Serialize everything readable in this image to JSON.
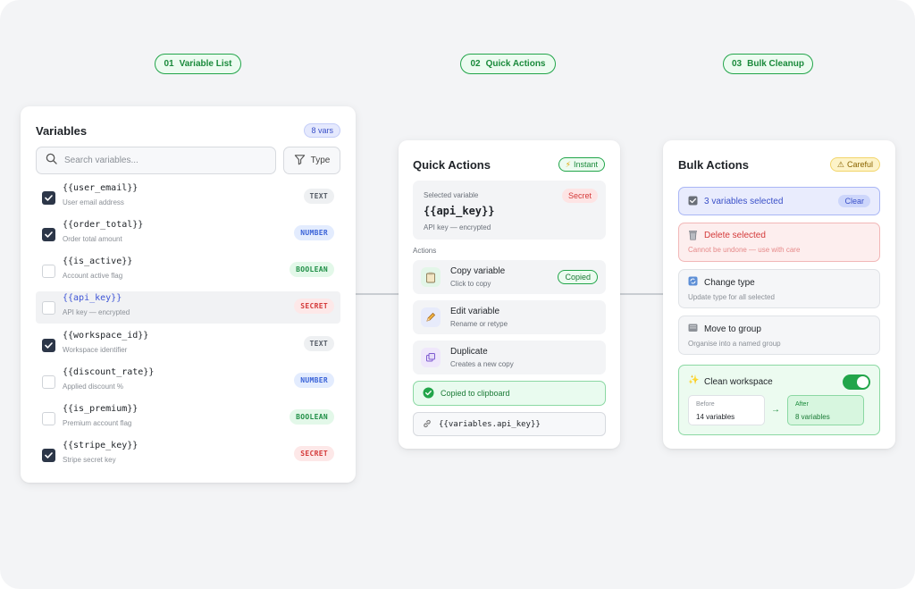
{
  "steps": [
    {
      "num": "01",
      "label": "Variable List"
    },
    {
      "num": "02",
      "label": "Quick Actions"
    },
    {
      "num": "03",
      "label": "Bulk Cleanup"
    }
  ],
  "variables_card": {
    "title": "Variables",
    "count_badge": "8 vars",
    "search_placeholder": "Search variables...",
    "type_filter_label": "Type",
    "rows": [
      {
        "name": "{{user_email}}",
        "desc": "User email address",
        "type": "TEXT",
        "checked": true
      },
      {
        "name": "{{order_total}}",
        "desc": "Order total amount",
        "type": "NUMBER",
        "checked": true
      },
      {
        "name": "{{is_active}}",
        "desc": "Account active flag",
        "type": "BOOLEAN",
        "checked": false
      },
      {
        "name": "{{api_key}}",
        "desc": "API key — encrypted",
        "type": "SECRET",
        "checked": false,
        "highlighted": true
      },
      {
        "name": "{{workspace_id}}",
        "desc": "Workspace identifier",
        "type": "TEXT",
        "checked": true
      },
      {
        "name": "{{discount_rate}}",
        "desc": "Applied discount %",
        "type": "NUMBER",
        "checked": false
      },
      {
        "name": "{{is_premium}}",
        "desc": "Premium account flag",
        "type": "BOOLEAN",
        "checked": false
      },
      {
        "name": "{{stripe_key}}",
        "desc": "Stripe secret key",
        "type": "SECRET",
        "checked": true
      }
    ]
  },
  "quick_actions_card": {
    "title": "Quick Actions",
    "badge": "Instant",
    "selected_label": "Selected variable",
    "selected_tag": "Secret",
    "selected_value": "{{api_key}}",
    "selected_desc": "API key — encrypted",
    "actions_label": "Actions",
    "actions": [
      {
        "label": "Copy variable",
        "desc": "Click to copy",
        "icon": "clipboard-icon",
        "status": "Copied"
      },
      {
        "label": "Edit variable",
        "desc": "Rename or retype",
        "icon": "pencil-icon"
      },
      {
        "label": "Duplicate",
        "desc": "Creates a new copy",
        "icon": "duplicate-icon"
      }
    ],
    "toast": "Copied to clipboard",
    "reference": "{{variables.api_key}}"
  },
  "bulk_card": {
    "title": "Bulk Actions",
    "badge": "Careful",
    "selection_label": "3 variables selected",
    "clear_label": "Clear",
    "delete_label": "Delete selected",
    "delete_desc": "Cannot be undone — use with care",
    "change_type_label": "Change type",
    "change_type_desc": "Update type for all selected",
    "move_label": "Move to group",
    "move_desc": "Organise into a named group",
    "clean_label": "Clean workspace",
    "clean_enabled": true,
    "before_label": "Before",
    "before_value": "14 variables",
    "after_label": "After",
    "after_value": "8 variables"
  },
  "colors": {
    "accent_green": "#22a54a",
    "accent_blue": "#3e55d6",
    "danger_red": "#d43a3a",
    "checkbox_dark": "#2c3648"
  }
}
